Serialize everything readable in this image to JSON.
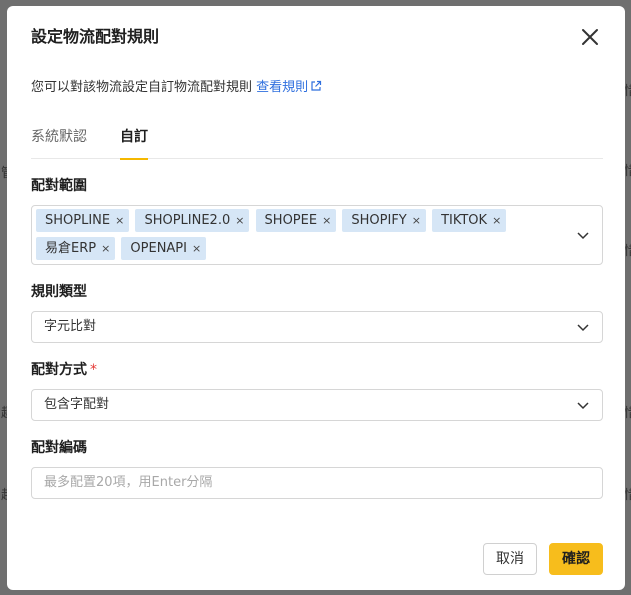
{
  "backdrop": {
    "fragments": [
      "管",
      "趣",
      "趙",
      "趙",
      "惜",
      "惜",
      "惜",
      "惜",
      "惜"
    ]
  },
  "dialog": {
    "title": "設定物流配對規則",
    "close_icon": "close-icon",
    "description": "您可以對該物流設定自訂物流配對規則",
    "rules_link": "查看規則",
    "link_icon": "external-link-icon"
  },
  "tabs": [
    {
      "label": "系統默認",
      "active": false
    },
    {
      "label": "自訂",
      "active": true
    }
  ],
  "match_scope": {
    "label": "配對範圍",
    "tags": [
      "SHOPLINE",
      "SHOPLINE2.0",
      "SHOPEE",
      "SHOPIFY",
      "TIKTOK",
      "易倉ERP",
      "OPENAPI"
    ],
    "tag_remove_symbol": "×"
  },
  "rule_type": {
    "label": "規則類型",
    "value": "字元比對"
  },
  "match_method": {
    "label": "配對方式",
    "required_mark": "*",
    "value": "包含字配對"
  },
  "match_code": {
    "label": "配對編碼",
    "placeholder": "最多配置20項，用Enter分隔"
  },
  "footer": {
    "cancel_label": "取消",
    "confirm_label": "確認"
  },
  "colors": {
    "accent": "#f7bd1c",
    "link": "#2f6fde",
    "tag_bg": "#d6e6f6",
    "required": "#e53935",
    "overlay": "#6f6f6f"
  }
}
